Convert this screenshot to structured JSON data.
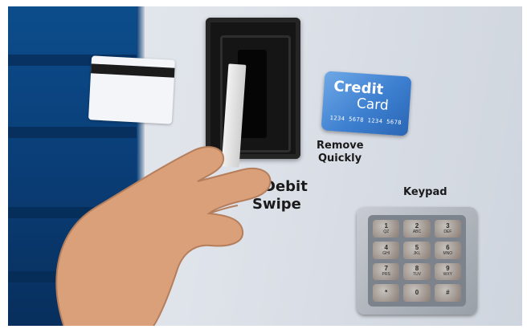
{
  "scene": {
    "description_labels": {
      "credit_card_line1": "Credit",
      "credit_card_line2": "Card",
      "credit_card_number": "1234 5678 1234 5678",
      "remove_line1": "Remove",
      "remove_line2": "Quickly",
      "debit": "Debit",
      "swipe": "Swipe",
      "keypad": "Keypad"
    },
    "keypad_keys": [
      {
        "digit": "1",
        "letters": "QZ"
      },
      {
        "digit": "2",
        "letters": "ABC"
      },
      {
        "digit": "3",
        "letters": "DEF"
      },
      {
        "digit": "4",
        "letters": "GHI"
      },
      {
        "digit": "5",
        "letters": "JKL"
      },
      {
        "digit": "6",
        "letters": "MNO"
      },
      {
        "digit": "7",
        "letters": "PRS"
      },
      {
        "digit": "8",
        "letters": "TUV"
      },
      {
        "digit": "9",
        "letters": "WXY"
      },
      {
        "digit": "*",
        "letters": ""
      },
      {
        "digit": "0",
        "letters": ""
      },
      {
        "digit": "#",
        "letters": ""
      }
    ],
    "colors": {
      "panel_blue": "#0a3f79",
      "credit_card_blue": "#3d7fd0",
      "reader_black": "#151515",
      "keypad_metal": "#9aa0a8"
    }
  }
}
